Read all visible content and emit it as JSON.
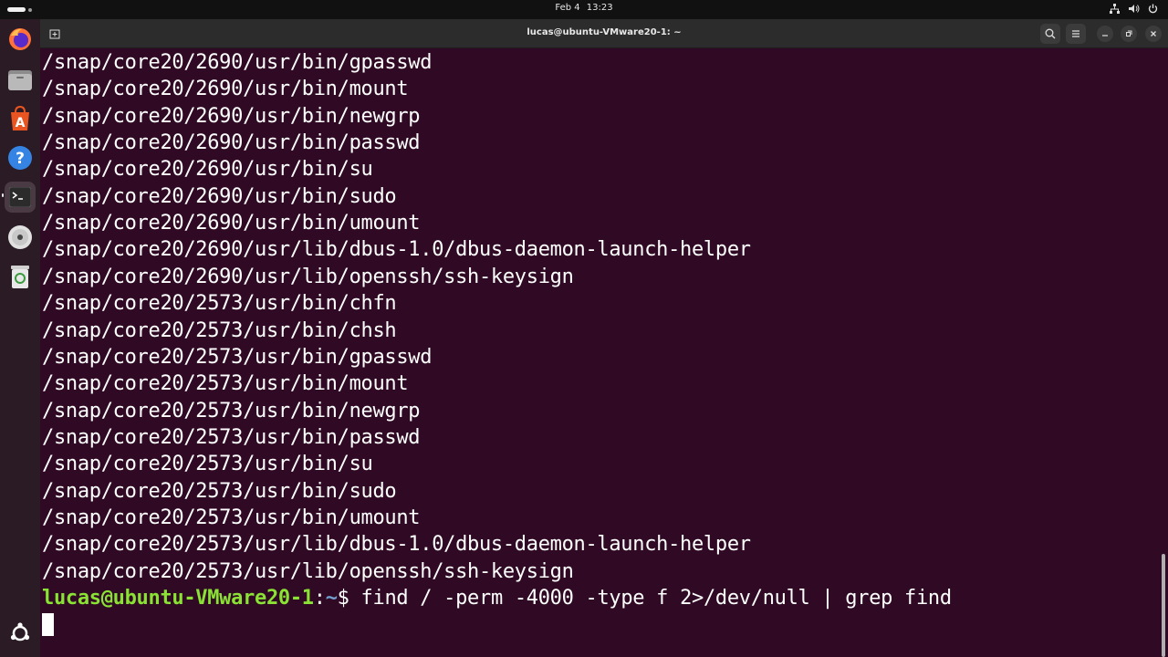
{
  "topbar": {
    "date": "Feb 4",
    "time": "13:23",
    "tray_icons": [
      "network-icon",
      "volume-icon",
      "power-icon"
    ]
  },
  "dock": {
    "items": [
      {
        "name": "firefox-icon",
        "label": "Firefox"
      },
      {
        "name": "files-icon",
        "label": "Files"
      },
      {
        "name": "app-center-icon",
        "label": "App Center"
      },
      {
        "name": "help-icon",
        "label": "Help"
      },
      {
        "name": "terminal-icon",
        "label": "Terminal"
      },
      {
        "name": "disc-icon",
        "label": "Disc"
      },
      {
        "name": "trash-icon",
        "label": "Trash"
      }
    ],
    "show_apps_icon": "ubuntu-apps-icon"
  },
  "window": {
    "title": "lucas@ubuntu-VMware20-1: ~"
  },
  "terminal": {
    "lines": [
      "/snap/core20/2690/usr/bin/gpasswd",
      "/snap/core20/2690/usr/bin/mount",
      "/snap/core20/2690/usr/bin/newgrp",
      "/snap/core20/2690/usr/bin/passwd",
      "/snap/core20/2690/usr/bin/su",
      "/snap/core20/2690/usr/bin/sudo",
      "/snap/core20/2690/usr/bin/umount",
      "/snap/core20/2690/usr/lib/dbus-1.0/dbus-daemon-launch-helper",
      "/snap/core20/2690/usr/lib/openssh/ssh-keysign",
      "/snap/core20/2573/usr/bin/chfn",
      "/snap/core20/2573/usr/bin/chsh",
      "/snap/core20/2573/usr/bin/gpasswd",
      "/snap/core20/2573/usr/bin/mount",
      "/snap/core20/2573/usr/bin/newgrp",
      "/snap/core20/2573/usr/bin/passwd",
      "/snap/core20/2573/usr/bin/su",
      "/snap/core20/2573/usr/bin/sudo",
      "/snap/core20/2573/usr/bin/umount",
      "/snap/core20/2573/usr/lib/dbus-1.0/dbus-daemon-launch-helper",
      "/snap/core20/2573/usr/lib/openssh/ssh-keysign"
    ],
    "prompt": {
      "user_host": "lucas@ubuntu-VMware20-1",
      "separator": ":",
      "path": "~",
      "symbol": "$",
      "command": " find / -perm -4000 -type f 2>/dev/null | grep find"
    }
  },
  "colors": {
    "terminal_bg": "#300a24",
    "prompt_user": "#8ae234",
    "prompt_path": "#729fcf"
  }
}
